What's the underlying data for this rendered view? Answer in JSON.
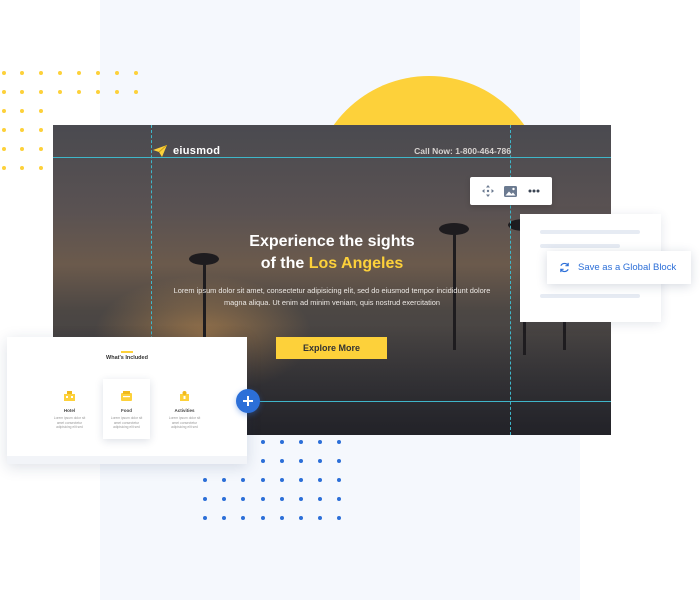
{
  "hero": {
    "brand": "eiusmod",
    "phone": "Call Now: 1-800-464-786",
    "heading_line1": "Experience the sights",
    "heading_prefix": "of the ",
    "heading_highlight": "Los Angeles",
    "paragraph": "Lorem ipsum dolor sit amet, consectetur adipisicing elit, sed do eiusmod tempor incididunt dolore magna aliqua. Ut enim ad minim veniam, quis nostrud exercitation",
    "cta_label": "Explore More"
  },
  "toolbar": {
    "icons": [
      "move-icon",
      "image-icon",
      "more-icon"
    ]
  },
  "global_block": {
    "label": "Save as a Global Block",
    "icon": "refresh-icon"
  },
  "included": {
    "title": "What's Included",
    "cards": [
      {
        "label": "Hotel",
        "desc": "Lorem ipsum dolor sit amet consectetur adipisicing elit sed",
        "icon": "hotel-icon"
      },
      {
        "label": "Food",
        "desc": "Lorem ipsum dolor sit amet consectetur adipisicing elit sed",
        "icon": "food-icon"
      },
      {
        "label": "Activities",
        "desc": "Lorem ipsum dolor sit amet consectetur adipisicing elit sed",
        "icon": "activities-icon"
      }
    ]
  },
  "add_button": {
    "label": "+"
  },
  "colors": {
    "accent_yellow": "#fdd13a",
    "accent_blue": "#2c6fd8",
    "guide_line": "#3fb6c9",
    "background_panel": "#f5f8fd"
  }
}
